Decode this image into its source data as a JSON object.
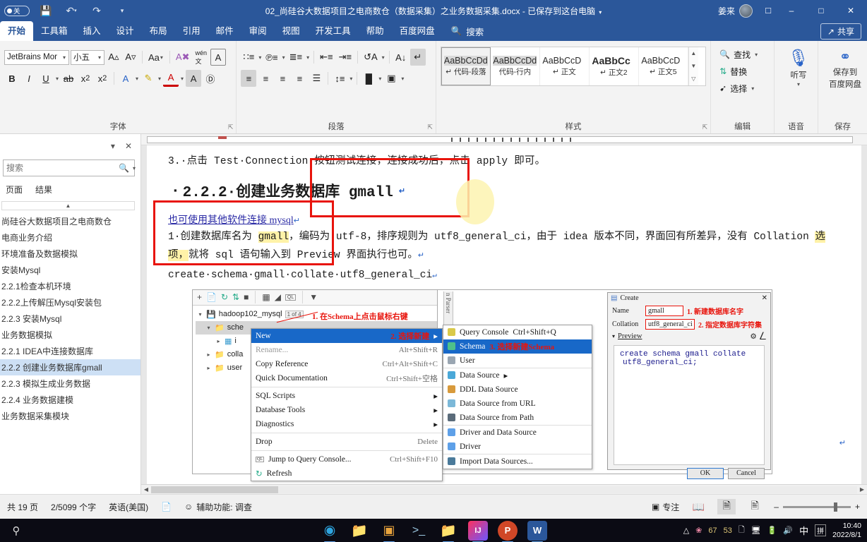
{
  "titlebar": {
    "autosave_label": "关",
    "icons": [
      "save-icon",
      "undo-icon",
      "redo-icon",
      "customize-qat-icon"
    ],
    "document_title": "02_尚硅谷大数据项目之电商数仓（数据采集）之业务数据采集.docx",
    "saved_state": " - 已保存到这台电脑",
    "account_name": "姜来",
    "window_buttons": [
      "–",
      "❐",
      "✕"
    ]
  },
  "ribbon_tabs": {
    "items": [
      "开始",
      "工具箱",
      "插入",
      "设计",
      "布局",
      "引用",
      "邮件",
      "审阅",
      "视图",
      "开发工具",
      "帮助",
      "百度网盘"
    ],
    "active": "开始",
    "search_label": "搜索",
    "share_label": "共享"
  },
  "ribbon": {
    "font_group": {
      "label": "字体",
      "font_name": "JetBrains Mor",
      "font_size": "小五",
      "buttons": [
        "grow-font-icon",
        "shrink-font-icon",
        "change-case-icon",
        "clear-formatting-icon",
        "phonetic-guide-icon",
        "character-border-icon",
        "bold-icon",
        "italic-icon",
        "underline-icon",
        "strikethrough-icon",
        "subscript-icon",
        "superscript-icon",
        "text-effects-icon",
        "highlight-icon",
        "font-color-icon",
        "character-shading-icon",
        "enclose-character-icon"
      ]
    },
    "paragraph_group": {
      "label": "段落",
      "buttons": [
        "bullets-icon",
        "numbering-icon",
        "multilevel-list-icon",
        "decrease-indent-icon",
        "increase-indent-icon",
        "sort-icon",
        "show-marks-icon",
        "align-left-icon",
        "align-center-icon",
        "align-right-icon",
        "justify-icon",
        "distribute-icon",
        "line-spacing-icon",
        "shading-icon",
        "borders-icon"
      ]
    },
    "styles_group": {
      "label": "样式",
      "items": [
        {
          "preview": "AaBbCcDdE",
          "name": "代码-段落",
          "selected": true
        },
        {
          "preview": "AaBbCcDdE",
          "name": "代码-行内",
          "selected": false
        },
        {
          "preview": "AaBbCcD",
          "name": "正文",
          "selected": false
        },
        {
          "preview": "AaBbCc",
          "name": "正文2",
          "selected": false
        },
        {
          "preview": "AaBbCcD",
          "name": "正文5",
          "selected": false
        }
      ]
    },
    "editing_group": {
      "label": "编辑",
      "items": [
        {
          "label": "查找",
          "icon": "search-icon",
          "dropdown": true
        },
        {
          "label": "替换",
          "icon": "replace-icon",
          "dropdown": false
        },
        {
          "label": "选择",
          "icon": "select-icon",
          "dropdown": true
        }
      ]
    },
    "voice_group": {
      "label": "语音",
      "button": "听写",
      "icon": "microphone-icon"
    },
    "save_group": {
      "label": "保存",
      "button_line1": "保存到",
      "button_line2": "百度网盘",
      "icon": "baidu-netdisk-icon"
    }
  },
  "navpane": {
    "search_placeholder": "搜索",
    "tabs": [
      "页面",
      "结果"
    ],
    "items": [
      {
        "label": "尚硅谷大数据项目之电商数仓",
        "selected": false
      },
      {
        "label": "电商业务介绍",
        "selected": false
      },
      {
        "label": "环境准备及数据模拟",
        "selected": false
      },
      {
        "label": "安装Mysql",
        "selected": false
      },
      {
        "label": "2.2.1检查本机环境",
        "selected": false
      },
      {
        "label": "2.2.2上传解压Mysql安装包",
        "selected": false
      },
      {
        "label": "2.2.3 安装Mysql",
        "selected": false
      },
      {
        "label": "业务数据模拟",
        "selected": false
      },
      {
        "label": "2.2.1 IDEA中连接数据库",
        "selected": false
      },
      {
        "label": "2.2.2 创建业务数据库gmall",
        "selected": true
      },
      {
        "label": "2.2.3 模拟生成业务数据",
        "selected": false
      },
      {
        "label": "2.2.4 业务数据建模",
        "selected": false
      },
      {
        "label": "业务数据采集模块",
        "selected": false
      }
    ]
  },
  "document": {
    "line_step3": "3.·点击 Test·Connection·按钮测试连接，连接成功后，点击 apply 即可。",
    "heading": "2.2.2·创建业务数据库 gmall",
    "link_text": "也可使用其他软件连接 mysql",
    "para1_a": "1·创建数据库名为 ",
    "para1_b": "gmall",
    "para1_c": "，编码为 utf-8，排序规则为 utf8_general_ci，由于 idea 版本不同，界面回有所差异，没有 Collation ",
    "para1_d": "选项，",
    "para1_e": "就将 sql 语句输入到 Preview 界面执行也可。",
    "code_line": "create·schema·gmall·collate·utf8_general_ci"
  },
  "embedded": {
    "ij_tree": {
      "root": "hadoop102_mysql",
      "root_badge": "1 of 4",
      "children": [
        "sche",
        "i",
        "colla",
        "user"
      ]
    },
    "annotations": {
      "a1": "1. 在Schema上点击鼠标右键",
      "a2": "2. 选择新建",
      "a3": "3. 选择新建Schema"
    },
    "context_menu": [
      {
        "label": "New",
        "key": "",
        "submenu": true,
        "highlight": true
      },
      {
        "label": "Rename...",
        "key": "Alt+Shift+R",
        "disabled": true
      },
      {
        "label": "Copy Reference",
        "key": "Ctrl+Alt+Shift+C"
      },
      {
        "label": "Quick Documentation",
        "key": "Ctrl+Shift+空格"
      },
      {
        "label": "SQL Scripts",
        "key": "",
        "submenu": true
      },
      {
        "label": "Database Tools",
        "key": "",
        "submenu": true
      },
      {
        "label": "Diagnostics",
        "key": "",
        "submenu": true
      },
      {
        "label": "Drop",
        "key": "Delete"
      },
      {
        "label": "Jump to Query Console...",
        "key": "Ctrl+Shift+F10",
        "icon": "query-console-icon"
      },
      {
        "label": "Refresh",
        "key": "",
        "icon": "refresh-icon"
      }
    ],
    "submenu": [
      {
        "label": "Query Console",
        "key": "Ctrl+Shift+Q",
        "color": "#d9c94a"
      },
      {
        "label": "Schema",
        "key": "",
        "highlight": true,
        "color": "#4ec08a"
      },
      {
        "label": "User",
        "key": "",
        "color": "#9aa6b2"
      },
      {
        "label": "Data Source",
        "key": "",
        "submenu": true,
        "color": "#4aa8d8"
      },
      {
        "label": "DDL Data Source",
        "key": "",
        "color": "#d89a3c"
      },
      {
        "label": "Data Source from URL",
        "key": "",
        "color": "#7bb8d8"
      },
      {
        "label": "Data Source from Path",
        "key": "",
        "color": "#5a6b7a"
      },
      {
        "label": "Driver and Data Source",
        "key": "",
        "color": "#5ea0e8"
      },
      {
        "label": "Driver",
        "key": "",
        "color": "#5ea0e8"
      },
      {
        "label": "Import Data Sources...",
        "key": "",
        "color": "#4a7a9a"
      }
    ],
    "create_dialog": {
      "title": "Create",
      "name_label": "Name",
      "name_value": "gmall",
      "collation_label": "Collation",
      "collation_value": "utf8_general_ci",
      "preview_label": "Preview",
      "preview_line1": "create schema gmall collate",
      "preview_line2": "utf8_general_ci;",
      "ok": "OK",
      "cancel": "Cancel",
      "ann_name": "1. 新建数据库名字",
      "ann_collation": "2. 指定数据库字符集"
    },
    "tab_label": "n Parser"
  },
  "statusbar": {
    "pages": "共 19 页",
    "words": "2/5099 个字",
    "language": "英语(美国)",
    "proofing_icon": "proofing-icon",
    "accessibility": "辅助功能: 调查",
    "focus": "专注",
    "views": [
      "read-mode-icon",
      "print-layout-icon",
      "web-layout-icon"
    ],
    "zoom_minus": "–",
    "zoom_plus": "+"
  },
  "taskbar": {
    "apps": [
      "edge-icon",
      "explorer-icon",
      "vmware-icon",
      "terminal-icon",
      "folder-icon",
      "intellij-icon",
      "powerpoint-icon",
      "word-icon"
    ],
    "tray_numbers": [
      "67",
      "53"
    ],
    "tray_icons": [
      "chevron-up-icon",
      "flower-icon",
      "copy-icon",
      "network-icon",
      "battery-icon",
      "volume-icon"
    ],
    "ime": "中",
    "ime_mode": "拼",
    "time": "10:40",
    "date": "2022/8/1"
  },
  "colors": {
    "word_blue": "#2b579a",
    "accent_red": "#e8140c",
    "select_blue": "#cde0f5",
    "menu_highlight": "#1868c8"
  }
}
